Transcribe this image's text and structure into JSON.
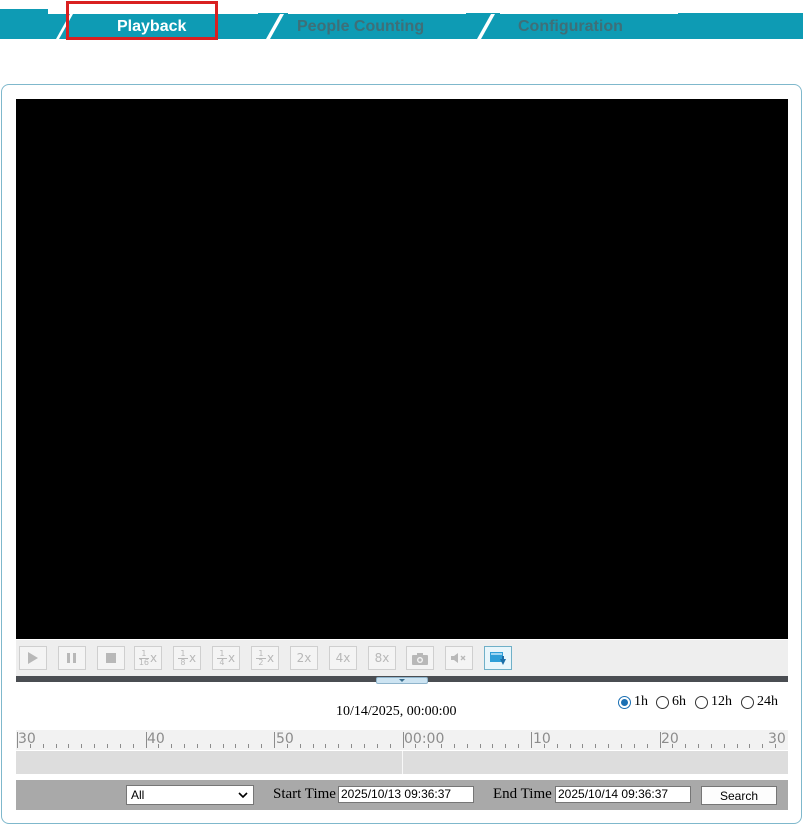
{
  "tabs": [
    {
      "label": "Playback",
      "active": true
    },
    {
      "label": "People Counting",
      "active": false
    },
    {
      "label": "Configuration",
      "active": false
    }
  ],
  "colors": {
    "tab_band": "#0e9bb4",
    "active_tab_text": "#ffffff",
    "inactive_tab_text": "#3e6f78",
    "highlight": "#d92020",
    "video_bg": "#000000",
    "radio_checked": "#1a6fb3"
  },
  "toolbar": {
    "buttons": [
      {
        "name": "play-icon"
      },
      {
        "name": "pause-icon"
      },
      {
        "name": "stop-icon"
      },
      {
        "name": "speed-1-16-icon",
        "num": "1",
        "den": "16",
        "suffix": "x"
      },
      {
        "name": "speed-1-8-icon",
        "num": "1",
        "den": "8",
        "suffix": "x"
      },
      {
        "name": "speed-1-4-icon",
        "num": "1",
        "den": "4",
        "suffix": "x"
      },
      {
        "name": "speed-1-2-icon",
        "num": "1",
        "den": "2",
        "suffix": "x"
      },
      {
        "name": "speed-2x-icon",
        "label": "2x"
      },
      {
        "name": "speed-4x-icon",
        "label": "4x"
      },
      {
        "name": "speed-8x-icon",
        "label": "8x"
      },
      {
        "name": "camera-icon"
      },
      {
        "name": "mute-icon"
      },
      {
        "name": "record-download-icon"
      }
    ]
  },
  "current_time": "10/14/2025, 00:00:00",
  "time_scale": {
    "options": [
      "1h",
      "6h",
      "12h",
      "24h"
    ],
    "selected": "1h"
  },
  "timeline": {
    "labels": [
      "30",
      "40",
      "50",
      "00:00",
      "10",
      "20",
      "30"
    ]
  },
  "search": {
    "type_selected": "All",
    "start_label": "Start Time",
    "start_value": "2025/10/13 09:36:37",
    "end_label": "End Time",
    "end_value": "2025/10/14 09:36:37",
    "button_label": "Search"
  }
}
